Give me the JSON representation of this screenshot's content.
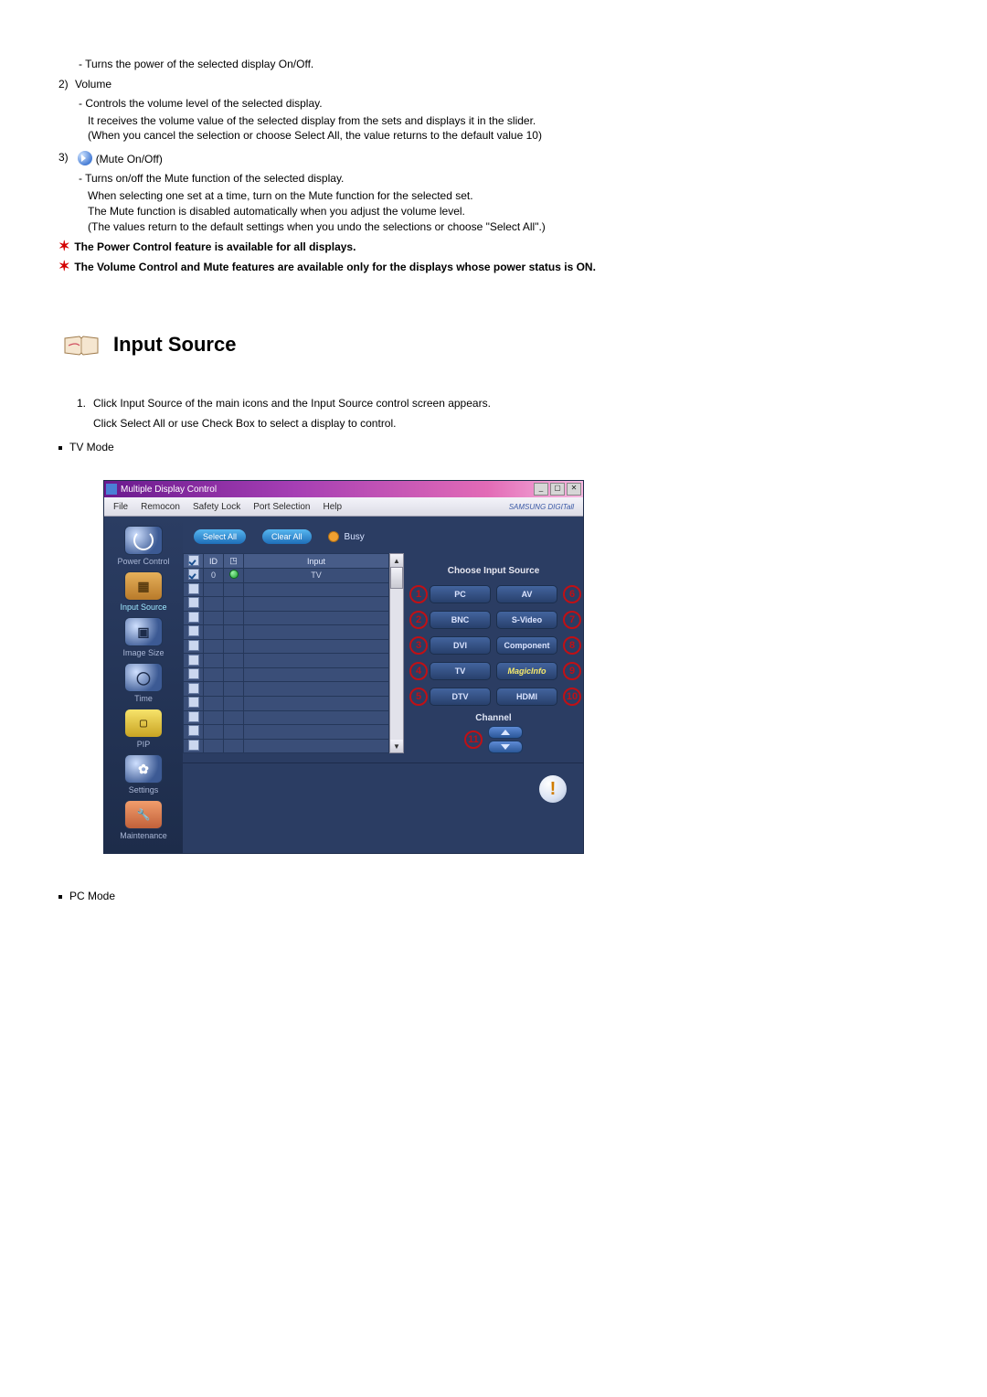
{
  "top": {
    "item1_desc": "- Turns the power of the selected display On/Off.",
    "item2_num": "2)",
    "item2_label": "Volume",
    "item2_l1": "- Controls the volume level of the selected display.",
    "item2_l2": "It receives the volume value of the selected display from the sets and displays it in the slider.",
    "item2_l3": "(When you cancel the selection or choose Select All, the value returns to the default value 10)",
    "item3_num": "3)",
    "item3_label": "(Mute On/Off)",
    "item3_l1": "- Turns on/off the Mute function of the selected display.",
    "item3_l2": "When selecting one set at a time, turn on the Mute function for the selected set.",
    "item3_l3": "The Mute function is disabled automatically when you adjust the volume level.",
    "item3_l4": "(The values return to the default settings when you undo the selections or choose \"Select All\".)",
    "note1": "The Power Control feature is available for all displays.",
    "note2": "The Volume Control and Mute features are available only for the displays whose power status is ON."
  },
  "section_title": "Input Source",
  "instr_num": "1.",
  "instr_l1": "Click Input Source of the main icons and the Input Source control screen appears.",
  "instr_l2": "Click Select All or use Check Box to select a display to control.",
  "tv_mode_label": "TV Mode",
  "pc_mode_label": "PC Mode",
  "mdc": {
    "title": "Multiple Display Control",
    "menu": {
      "file": "File",
      "remocon": "Remocon",
      "safety": "Safety Lock",
      "port": "Port Selection",
      "help": "Help",
      "logo": "SAMSUNG DIGITall"
    },
    "toolbar": {
      "select_all": "Select All",
      "clear_all": "Clear All",
      "busy": "Busy"
    },
    "sidebar": {
      "power": "Power Control",
      "input": "Input Source",
      "image": "Image Size",
      "time": "Time",
      "pip": "PIP",
      "settings": "Settings",
      "maint": "Maintenance"
    },
    "table": {
      "col_id": "ID",
      "col_input": "Input",
      "row0_id": "0",
      "row0_input": "TV"
    },
    "right": {
      "title": "Choose Input Source",
      "pc": "PC",
      "bnc": "BNC",
      "dvi": "DVI",
      "tv": "TV",
      "dtv": "DTV",
      "av": "AV",
      "svideo": "S-Video",
      "component": "Component",
      "magicinfo": "MagicInfo",
      "hdmi": "HDMI",
      "channel": "Channel"
    },
    "callouts": {
      "c1": "1",
      "c2": "2",
      "c3": "3",
      "c4": "4",
      "c5": "5",
      "c6": "6",
      "c7": "7",
      "c8": "8",
      "c9": "9",
      "c10": "10",
      "c11": "11"
    }
  }
}
